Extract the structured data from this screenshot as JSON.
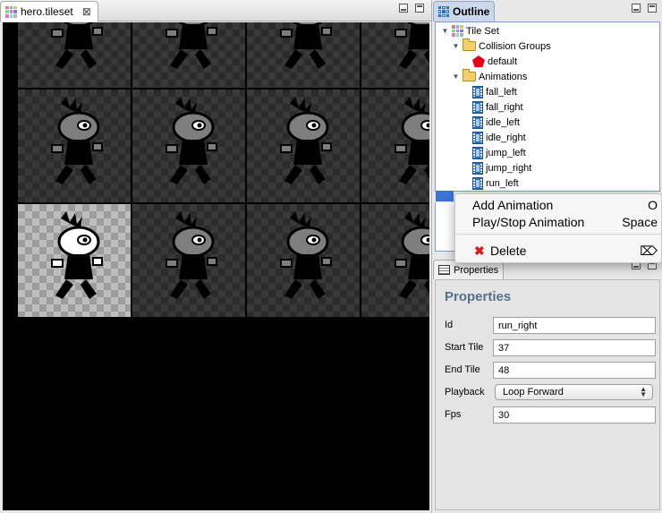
{
  "editor": {
    "tab_label": "hero.tileset",
    "tab_close": "⊠"
  },
  "outline": {
    "tab_label": "Outline",
    "tree": {
      "root": "Tile Set",
      "collision_groups": {
        "label": "Collision Groups",
        "items": [
          "default"
        ]
      },
      "animations": {
        "label": "Animations",
        "items": [
          "fall_left",
          "fall_right",
          "idle_left",
          "idle_right",
          "jump_left",
          "jump_right",
          "run_left"
        ]
      }
    }
  },
  "context_menu": {
    "items": [
      {
        "label": "Add Animation",
        "shortcut": "O"
      },
      {
        "label": "Play/Stop Animation",
        "shortcut": "Space"
      },
      {
        "label": "Delete",
        "shortcut": "⌦"
      }
    ]
  },
  "properties": {
    "tab_label": "Properties",
    "title": "Properties",
    "fields": {
      "id": {
        "label": "Id",
        "value": "run_right"
      },
      "start_tile": {
        "label": "Start Tile",
        "value": "37"
      },
      "end_tile": {
        "label": "End Tile",
        "value": "48"
      },
      "playback": {
        "label": "Playback",
        "value": "Loop Forward"
      },
      "fps": {
        "label": "Fps",
        "value": "30"
      }
    }
  },
  "colors": {
    "selection": "#3875d7",
    "properties_title": "#56708c",
    "delete_icon": "#d42020",
    "collision_default": "#e0001a"
  }
}
